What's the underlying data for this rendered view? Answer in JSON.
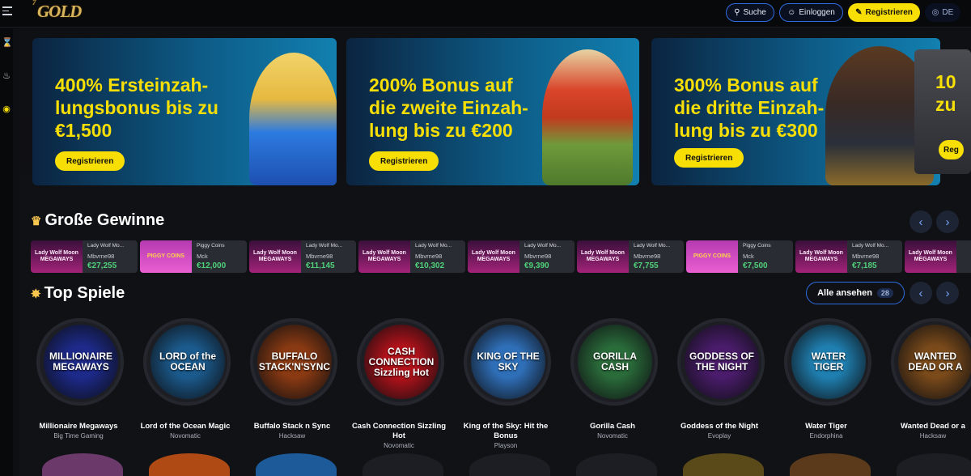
{
  "header": {
    "logo": "GOLD",
    "logo_small": "7",
    "search_label": "Suche",
    "login_label": "Einloggen",
    "register_label": "Registrieren",
    "lang_label": "DE"
  },
  "banners": [
    {
      "title": "400% Ersteinzah-\nlungsbonus bis zu\n€1,500",
      "button": "Registrieren"
    },
    {
      "title": "200% Bonus auf\ndie zweite Einzah-\nlung bis zu €200",
      "button": "Registrieren"
    },
    {
      "title": "300% Bonus auf\ndie dritte Einzah-\nlung bis zu €300",
      "button": "Registrieren"
    },
    {
      "title": "10\nzu",
      "button": "Reg"
    }
  ],
  "big_wins": {
    "title": "Große Gewinne",
    "items": [
      {
        "game": "Lady Wolf Mo...",
        "user": "Mbvrne98",
        "amount": "€27,255",
        "thumb": "Lady Wolf Moon MEGAWAYS"
      },
      {
        "game": "Piggy Coins",
        "user": "Mck",
        "amount": "€12,000",
        "thumb": "PIGGY COINS"
      },
      {
        "game": "Lady Wolf Mo...",
        "user": "Mbvrne98",
        "amount": "€11,145",
        "thumb": "Lady Wolf Moon MEGAWAYS"
      },
      {
        "game": "Lady Wolf Mo...",
        "user": "Mbvrne98",
        "amount": "€10,302",
        "thumb": "Lady Wolf Moon MEGAWAYS"
      },
      {
        "game": "Lady Wolf Mo...",
        "user": "Mbvrne98",
        "amount": "€9,390",
        "thumb": "Lady Wolf Moon MEGAWAYS"
      },
      {
        "game": "Lady Wolf Mo...",
        "user": "Mbvrne98",
        "amount": "€7,755",
        "thumb": "Lady Wolf Moon MEGAWAYS"
      },
      {
        "game": "Piggy Coins",
        "user": "Mck",
        "amount": "€7,500",
        "thumb": "PIGGY COINS"
      },
      {
        "game": "Lady Wolf Mo...",
        "user": "Mbvrne98",
        "amount": "€7,185",
        "thumb": "Lady Wolf Moon MEGAWAYS"
      },
      {
        "game": "",
        "user": "",
        "amount": "",
        "thumb": "Lady Wolf Moon MEGAWAYS"
      }
    ]
  },
  "top_games": {
    "title": "Top Spiele",
    "see_all": "Alle ansehen",
    "count": "28",
    "items": [
      {
        "name": "Millionaire Megaways",
        "provider": "Big Time Gaming",
        "art": "MILLIONAIRE MEGAWAYS",
        "color": "#1d2a8a"
      },
      {
        "name": "Lord of the Ocean Magic",
        "provider": "Novomatic",
        "art": "LORD of the OCEAN",
        "color": "#1b5a8c"
      },
      {
        "name": "Buffalo Stack n Sync",
        "provider": "Hacksaw",
        "art": "BUFFALO STACK'N'SYNC",
        "color": "#8a3a12"
      },
      {
        "name": "Cash Connection Sizzling Hot",
        "provider": "Novomatic",
        "art": "CASH CONNECTION Sizzling Hot",
        "color": "#b3121a"
      },
      {
        "name": "King of the Sky: Hit the Bonus",
        "provider": "Playson",
        "art": "KING OF THE SKY",
        "color": "#2f6fb8"
      },
      {
        "name": "Gorilla Cash",
        "provider": "Novomatic",
        "art": "GORILLA CASH",
        "color": "#2a6b3a"
      },
      {
        "name": "Goddess of the Night",
        "provider": "Evoplay",
        "art": "GODDESS OF THE NIGHT",
        "color": "#4a1c6b"
      },
      {
        "name": "Water Tiger",
        "provider": "Endorphina",
        "art": "WATER TIGER",
        "color": "#1f7fb0"
      },
      {
        "name": "Wanted Dead or a",
        "provider": "Hacksaw",
        "art": "WANTED DEAD OR A",
        "color": "#7a4a1a"
      }
    ]
  }
}
